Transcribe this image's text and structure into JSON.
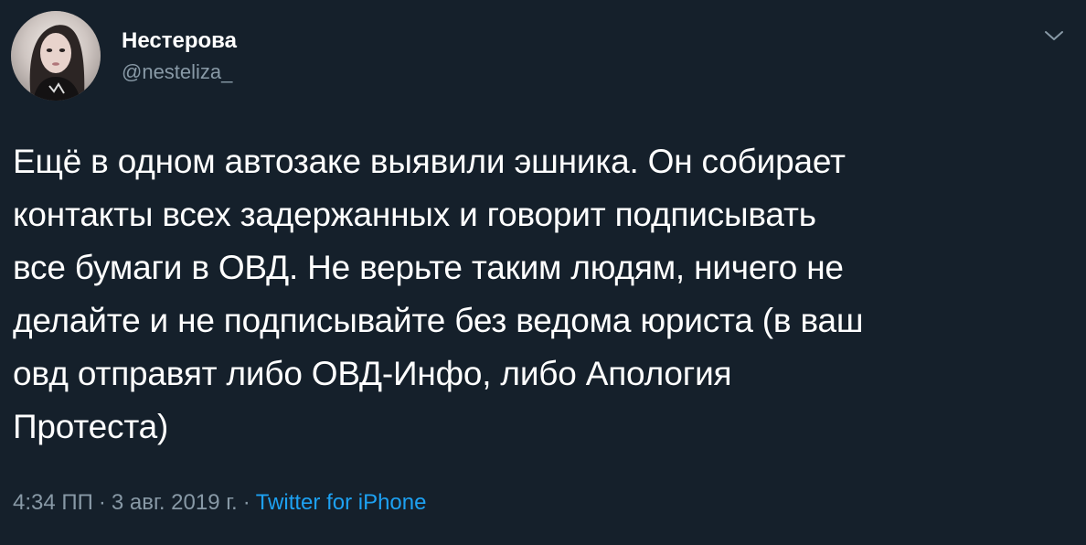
{
  "author": {
    "display_name": "Нестерова",
    "handle": "@nesteliza_"
  },
  "tweet": {
    "text": "Ещё в одном автозаке выявили эшника. Он собирает\nконтакты всех задержанных и говорит подписывать\nвсе бумаги в ОВД. Не верьте таким людям, ничего не\nделайте и не подписывайте без ведома юриста (в ваш\nовд отправят либо ОВД-Инфо, либо Апология\nПротеста)",
    "time": "4:34 ПП",
    "separator": "·",
    "date": "3 авг. 2019 г.",
    "source": "Twitter for iPhone"
  },
  "icons": {
    "menu": "chevron-down-icon",
    "avatar": "avatar"
  },
  "colors": {
    "background": "#15202b",
    "text": "#ffffff",
    "muted": "#8899a6",
    "link": "#1da1f2"
  }
}
